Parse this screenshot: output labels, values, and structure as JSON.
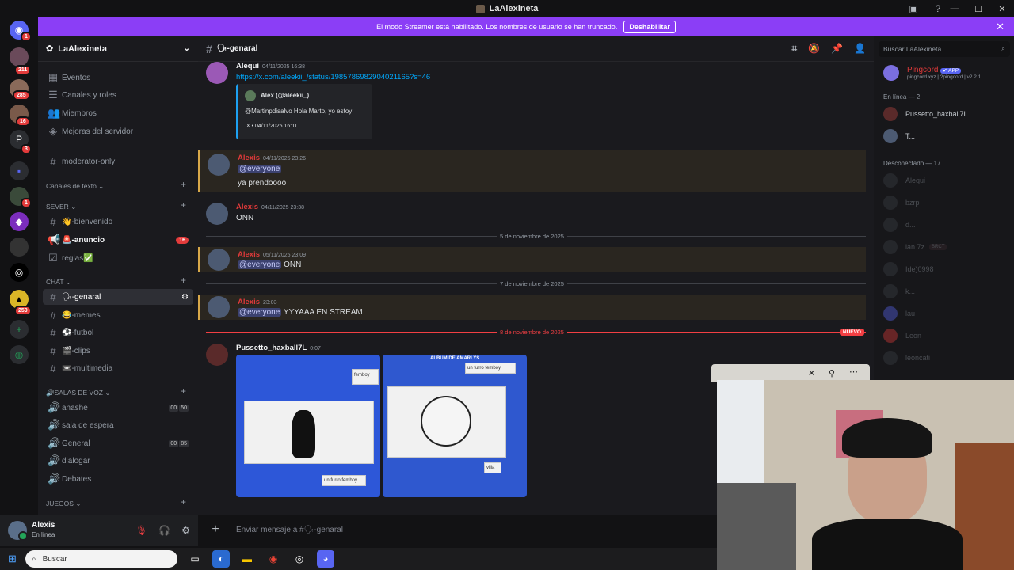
{
  "window": {
    "title": "LaAlexineta"
  },
  "rail": {
    "badges": [
      "1",
      "211",
      "285",
      "16",
      "3",
      "1",
      "250"
    ]
  },
  "banner": {
    "text": "El modo Streamer está habilitado. Los nombres de usuario se han truncado.",
    "button": "Deshabilitar"
  },
  "server": {
    "name": "LaAlexineta"
  },
  "channels": {
    "top": [
      {
        "label": "Eventos"
      },
      {
        "label": "Canales y roles"
      },
      {
        "label": "Miembros"
      },
      {
        "label": "Mejoras del servidor"
      }
    ],
    "moderator": "moderator-only",
    "cat_text": "Canales de texto",
    "cat_sever": "SEVER",
    "sever": [
      {
        "label": "👋-bienvenido"
      },
      {
        "label": "🚨-anuncio",
        "badge": "16"
      },
      {
        "label": "reglas✅"
      }
    ],
    "cat_chat": "CHAT",
    "chat": [
      {
        "label": "🗣-genaral"
      },
      {
        "label": "😂-memes"
      },
      {
        "label": "⚽-futbol"
      },
      {
        "label": "🎬-clips"
      },
      {
        "label": "📼-multimedia"
      }
    ],
    "cat_voice": "🔊SALAS DE VOZ",
    "voice": [
      {
        "label": "anashe",
        "a": "00",
        "b": "50"
      },
      {
        "label": "sala de espera"
      },
      {
        "label": "General",
        "a": "00",
        "b": "85"
      },
      {
        "label": "dialogar"
      },
      {
        "label": "Debates"
      }
    ],
    "cat_games": "JUEGOS"
  },
  "user": {
    "name": "Alexis",
    "status": "En línea"
  },
  "chat": {
    "channel": "🗣-genaral",
    "input_placeholder": "Enviar mensaje a #🗣-genaral",
    "messages": [
      {
        "author": "Alequi",
        "time": "04/11/2025 16:38",
        "link": "https://x.com/aleekii_/status/1985786982904021165?s=46",
        "embed": {
          "author": "Alex (@aleekii_)",
          "text": "@Martinpdisalvo Hola Marto, yo estoy",
          "footer": "X • 04/11/2025 16:11"
        }
      },
      {
        "author": "Alexis",
        "time": "04/11/2025 23:26",
        "mention": "@everyone",
        "text": "ya prendoooo"
      },
      {
        "author": "Alexis",
        "time": "04/11/2025 23:38",
        "text": "ONN"
      },
      {
        "author": "Alexis",
        "time": "05/11/2025 23:09",
        "mention": "@everyone",
        "text": " ONN"
      },
      {
        "author": "Alexis",
        "time": "23:03",
        "mention": "@everyone",
        "text": " YYYAAA EN STREAM"
      },
      {
        "author": "Pussetto_haxball7L",
        "time": "0:07"
      }
    ],
    "dividers": [
      "5 de noviembre de 2025",
      "7 de noviembre de 2025",
      "8 de noviembre de 2025"
    ],
    "new_label": "NUEVO",
    "image_texts": {
      "a": "femboy",
      "b": "un furro femboy",
      "c": "un furro femboy",
      "d": "ALBUM DE AMARLYS",
      "e": "villa"
    }
  },
  "members": {
    "search_placeholder": "Buscar LaAlexineta",
    "bot": {
      "name": "Pingcord",
      "tag": "✔ APP",
      "sub": "pingcord.xyz | ?pingcord | v2.2.1"
    },
    "online_header": "En línea — 2",
    "online": [
      "Pussetto_haxball7L",
      "T..."
    ],
    "offline_header": "Desconectado — 17",
    "offline": [
      "Alequi",
      "bzrp",
      "d...",
      "ian 7z",
      "Ide)0998",
      "k...",
      "lau",
      "Leon",
      "leoncati"
    ],
    "offline_tag": "BRCT"
  },
  "taskbar": {
    "search": "Buscar"
  },
  "colors": {
    "accent": "#8b3ef6",
    "alexis": "#e03a3a",
    "pingcord": "#e03a3a",
    "link": "#00a8fc"
  }
}
